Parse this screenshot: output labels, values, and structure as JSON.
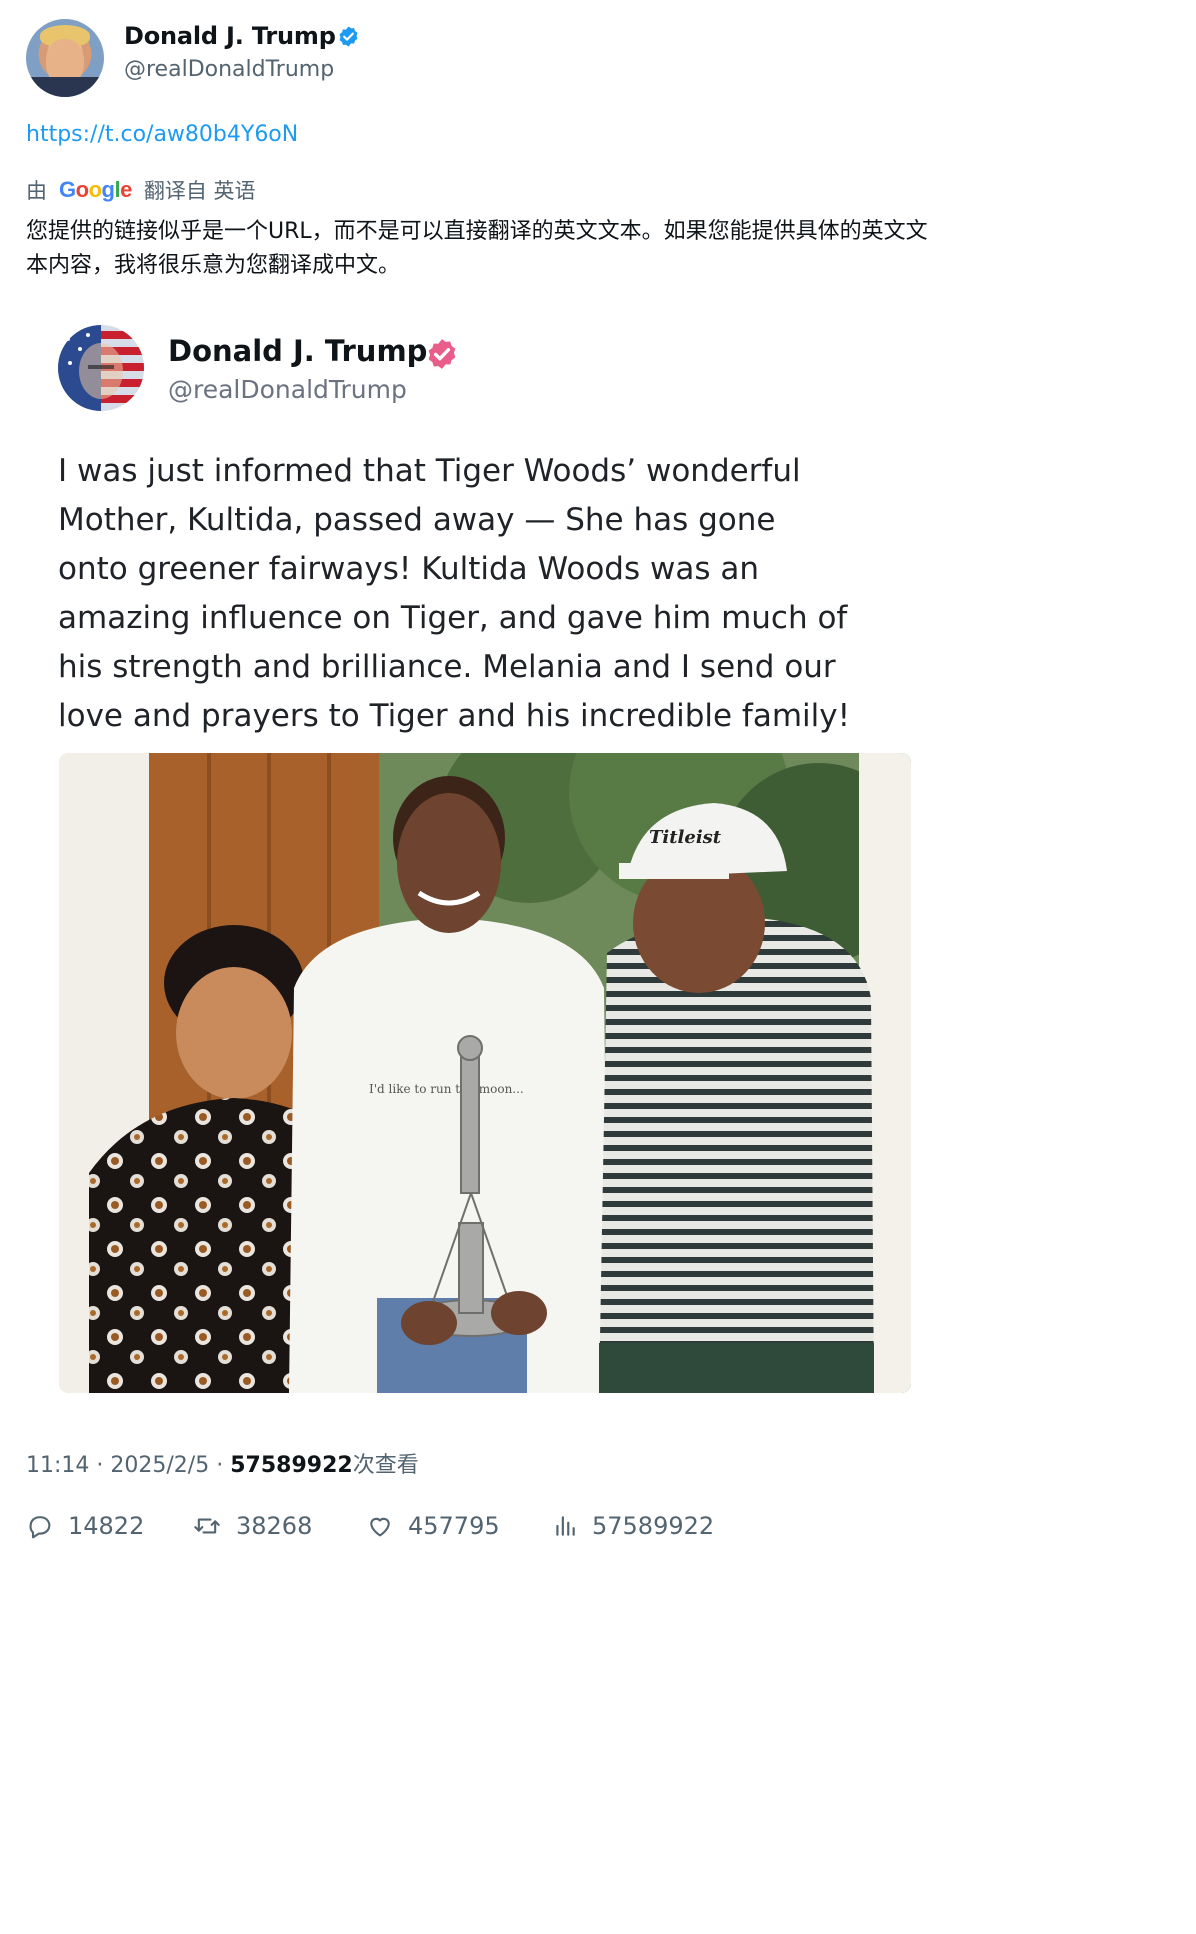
{
  "tweet": {
    "author": {
      "display_name": "Donald J. Trump",
      "handle": "@realDonaldTrump",
      "verified_icon": "verified-badge-icon",
      "verified_color": "#1d9bf0"
    },
    "link_text": "https://t.co/aw80b4Y6oN",
    "translation": {
      "prefix": "由",
      "provider": "Google",
      "suffix": "翻译自 英语",
      "text": "您提供的链接似乎是一个URL，而不是可以直接翻译的英文文本。如果您能提供具体的英文文本内容，我将很乐意为您翻译成中文。"
    },
    "meta": {
      "time": "11:14",
      "date": "2025/2/5",
      "views_count": "57589922",
      "views_label": "次查看"
    },
    "actions": {
      "replies": "14822",
      "retweets": "38268",
      "likes": "457795",
      "views": "57589922"
    }
  },
  "embedded_post": {
    "display_name": "Donald J. Trump",
    "handle": "@realDonaldTrump",
    "badge_color": "#e85d8a",
    "lines": [
      "I was just informed that Tiger Woods’ wonderful",
      "Mother, Kultida, passed away — She has gone",
      "onto greener fairways! Kultida Woods was an",
      "amazing influence on Tiger, and gave him much of",
      "his strength and brilliance. Melania and I send our",
      "love and prayers to Tiger and his incredible family!"
    ],
    "photo": {
      "shirt_text": "I'd like to run the moon...",
      "cap_text": "Titleist"
    }
  },
  "colors": {
    "link": "#1d9bf0",
    "secondary_text": "#536471",
    "primary_text": "#0f1419"
  }
}
